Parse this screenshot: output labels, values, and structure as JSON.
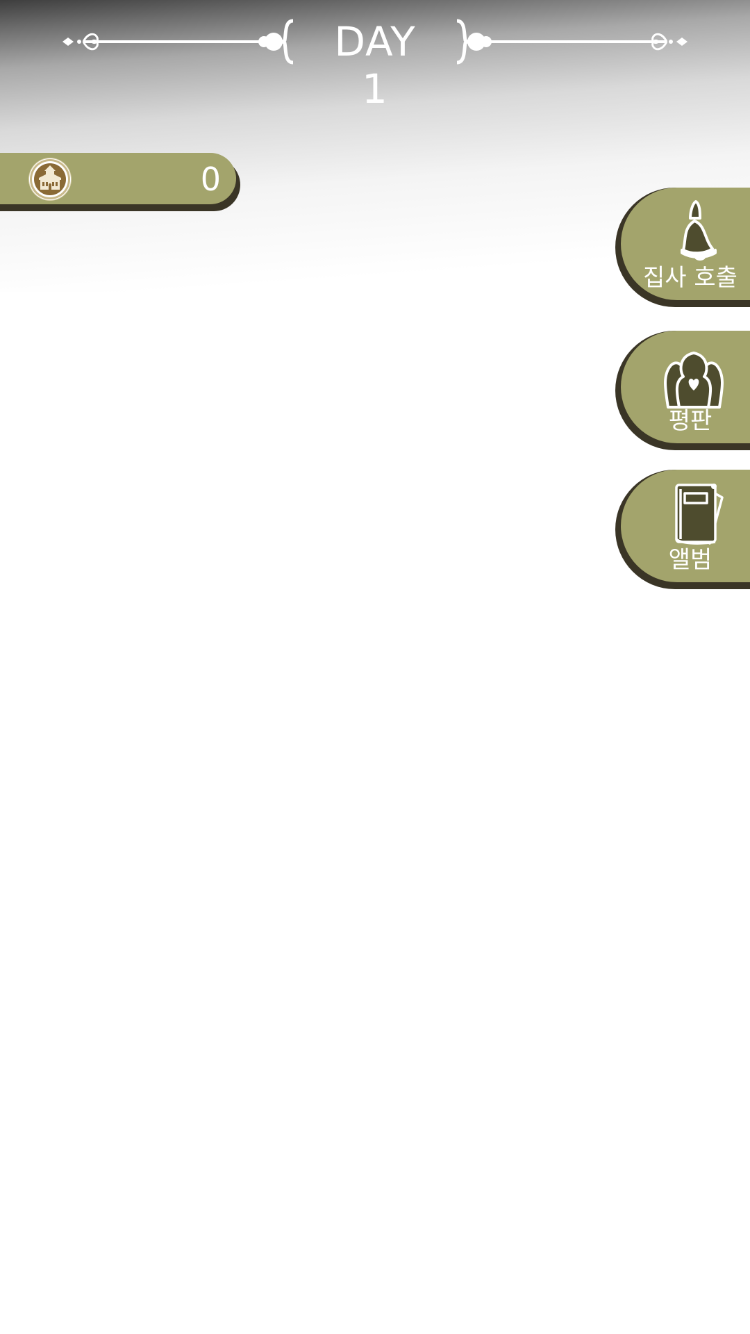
{
  "header": {
    "day_label": "DAY 1"
  },
  "currency": {
    "icon": "mansion-coin-icon",
    "value": "0"
  },
  "side_menu": {
    "butler_call": {
      "label": "집사 호출",
      "icon": "bell-icon"
    },
    "reputation": {
      "label": "평판",
      "icon": "people-heart-icon"
    },
    "album": {
      "label": "앨범",
      "icon": "book-album-icon"
    }
  },
  "colors": {
    "button_face": "#a3a46c",
    "button_shadow": "#3a3526",
    "icon_fill": "#4e4c2e",
    "text": "#ffffff"
  }
}
